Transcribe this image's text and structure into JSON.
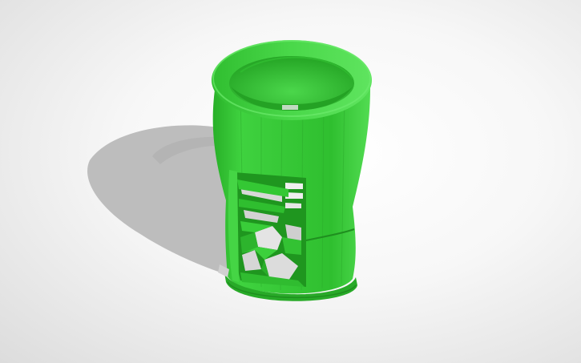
{
  "scene": {
    "object": "green-cylindrical-holder",
    "colors": {
      "background": "#f2f2f2",
      "model_base": "#2fc12f",
      "model_light": "#57e257",
      "model_dark": "#1c8f1c",
      "shadow": "#bdbdbd"
    }
  }
}
